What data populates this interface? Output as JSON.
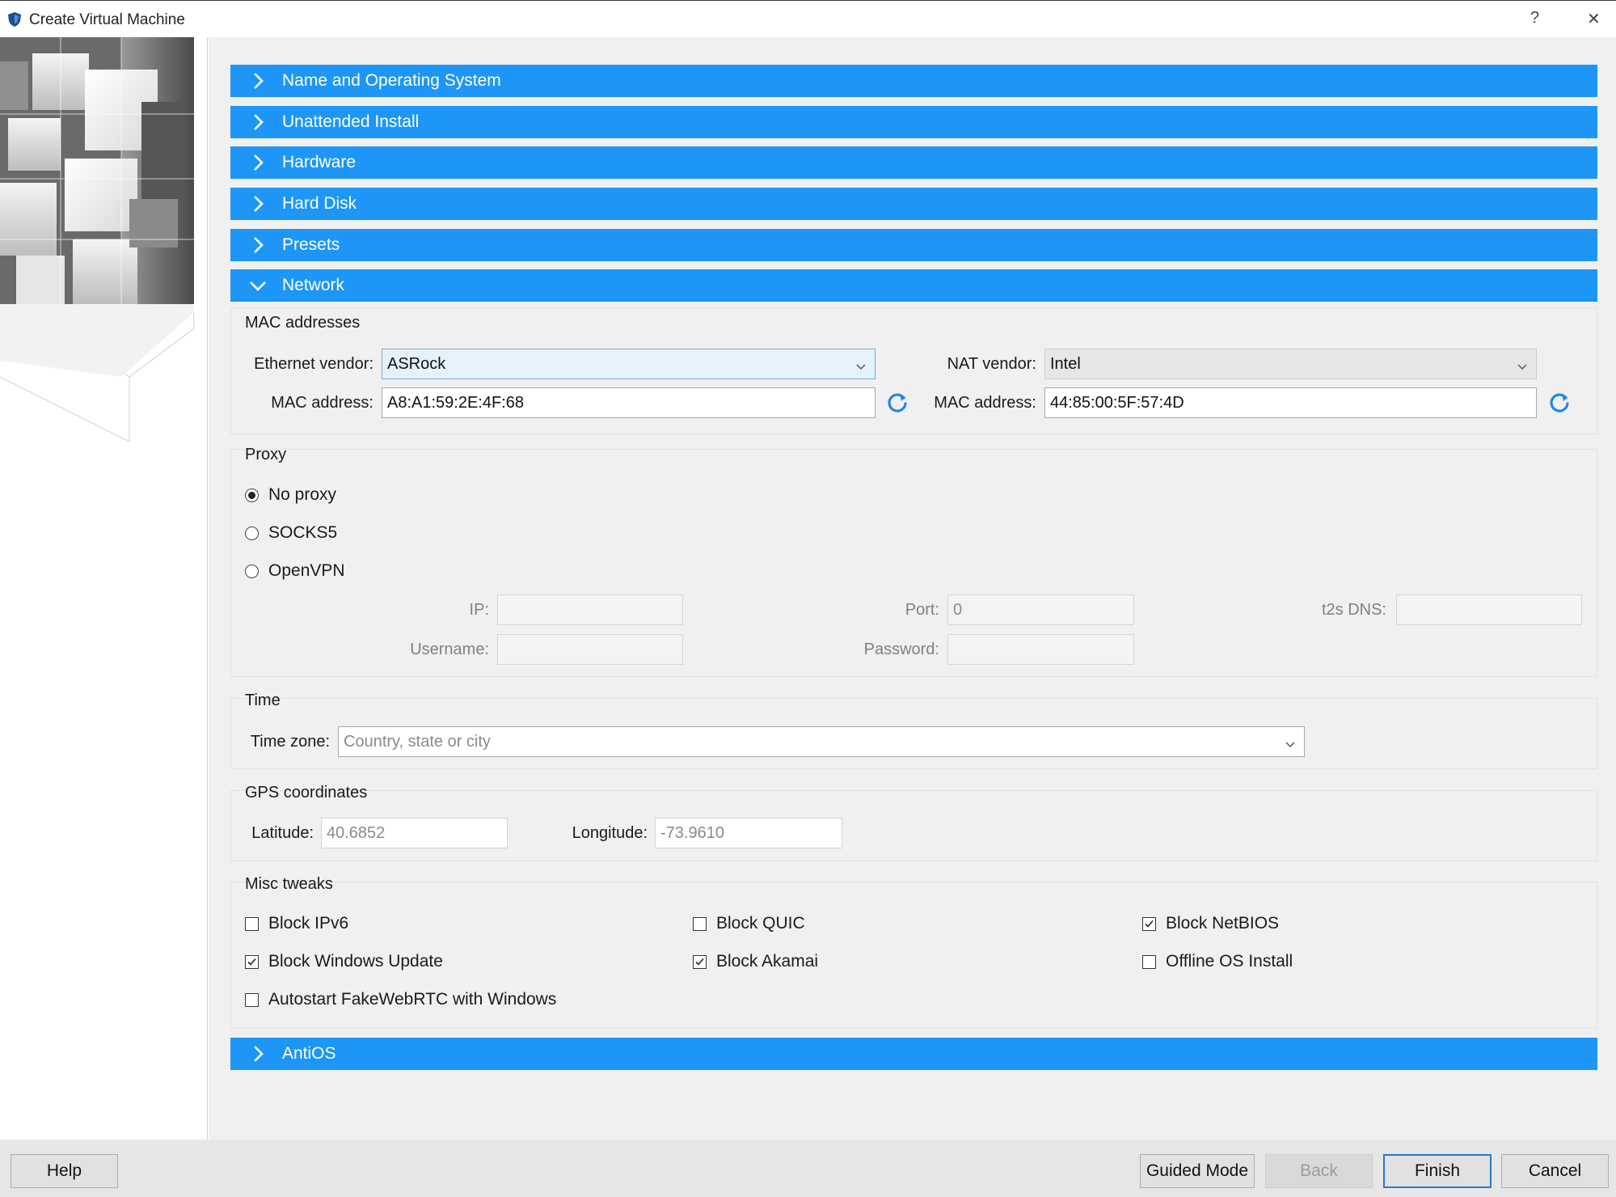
{
  "window": {
    "title": "Create Virtual Machine",
    "help_glyph": "?",
    "close_glyph": "✕",
    "icon": "shield-icon"
  },
  "sections": {
    "name_os": "Name and Operating System",
    "unattended": "Unattended Install",
    "hardware": "Hardware",
    "hard_disk": "Hard Disk",
    "presets": "Presets",
    "network": "Network",
    "antios": "AntiOS"
  },
  "mac": {
    "group_title": "MAC addresses",
    "ethernet_vendor_label": "Ethernet vendor:",
    "ethernet_vendor_value": "ASRock",
    "nat_vendor_label": "NAT vendor:",
    "nat_vendor_value": "Intel",
    "mac_label": "MAC address:",
    "ethernet_mac_value": "A8:A1:59:2E:4F:68",
    "nat_mac_value": "44:85:00:5F:57:4D"
  },
  "proxy": {
    "group_title": "Proxy",
    "options": [
      "No proxy",
      "SOCKS5",
      "OpenVPN"
    ],
    "selected": "No proxy",
    "ip_label": "IP:",
    "ip_value": "",
    "port_label": "Port:",
    "port_value": "0",
    "dns_label": "t2s DNS:",
    "dns_value": "",
    "username_label": "Username:",
    "username_value": "",
    "password_label": "Password:",
    "password_value": ""
  },
  "time": {
    "group_title": "Time",
    "timezone_label": "Time zone:",
    "timezone_placeholder": "Country, state or city"
  },
  "gps": {
    "group_title": "GPS coordinates",
    "latitude_label": "Latitude:",
    "latitude_value": "40.6852",
    "longitude_label": "Longitude:",
    "longitude_value": "-73.9610"
  },
  "misc": {
    "group_title": "Misc tweaks",
    "block_ipv6": "Block IPv6",
    "block_ipv6_checked": false,
    "block_quic": "Block QUIC",
    "block_quic_checked": false,
    "block_netbios": "Block NetBIOS",
    "block_netbios_checked": true,
    "block_windows_update": "Block Windows Update",
    "block_windows_update_checked": true,
    "block_akamai": "Block Akamai",
    "block_akamai_checked": true,
    "offline_os_install": "Offline OS Install",
    "offline_os_install_checked": false,
    "autostart_fakewebrtc": "Autostart FakeWebRTC with Windows",
    "autostart_fakewebrtc_checked": false
  },
  "footer": {
    "help": "Help",
    "guided_mode": "Guided Mode",
    "back": "Back",
    "finish": "Finish",
    "cancel": "Cancel"
  },
  "colors": {
    "section_header": "#1e96f7",
    "refresh_icon": "#1e88e5",
    "focus_border": "#2b78c6"
  }
}
